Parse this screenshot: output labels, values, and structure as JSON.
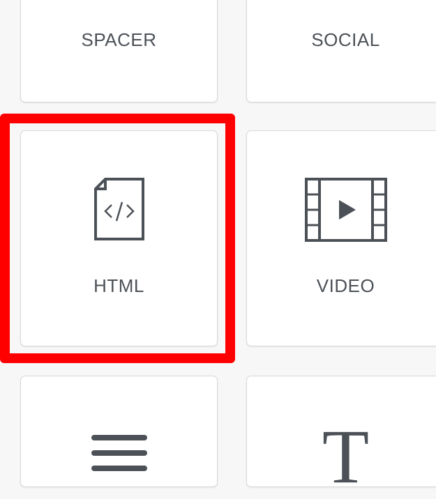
{
  "colors": {
    "background": "#f7f7f7",
    "tile_background": "#ffffff",
    "tile_border": "#d8d8d8",
    "label_color": "#4c5157",
    "icon_color": "#4c5157",
    "highlight_color": "#ff0000"
  },
  "tiles": [
    {
      "label": "SPACER",
      "icon": "",
      "selected": false
    },
    {
      "label": "SOCIAL",
      "icon": "",
      "selected": false
    },
    {
      "label": "HTML",
      "icon": "html-file-icon",
      "selected": true
    },
    {
      "label": "VIDEO",
      "icon": "video-film-icon",
      "selected": false
    },
    {
      "label": "",
      "icon": "divider-lines-icon",
      "selected": false
    },
    {
      "label": "",
      "icon": "text-T-icon",
      "glyph": "T",
      "selected": false
    }
  ]
}
